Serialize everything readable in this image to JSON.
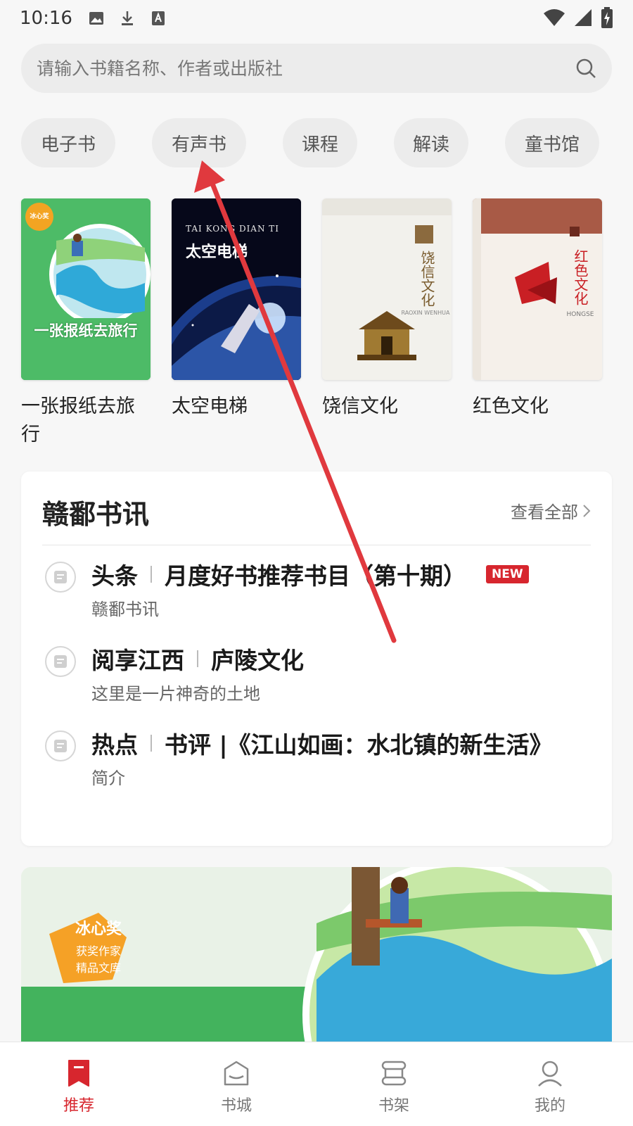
{
  "status_bar": {
    "time": "10:16"
  },
  "search": {
    "placeholder": "请输入书籍名称、作者或出版社"
  },
  "categories": [
    "电子书",
    "有声书",
    "课程",
    "解读",
    "童书馆"
  ],
  "books": [
    {
      "title": "一张报纸去旅行",
      "cover_text": "一张报纸去旅行",
      "cover_badge": "冰心奖"
    },
    {
      "title": "太空电梯",
      "cover_text": "太空电梯",
      "cover_pinyin": "TAI KONG DIAN TI"
    },
    {
      "title": "饶信文化",
      "cover_text": "饶信文化",
      "cover_pinyin": "RAOXIN WENHUA"
    },
    {
      "title": "红色文化",
      "cover_text": "红色文化",
      "cover_pinyin": "HONGSE"
    }
  ],
  "news": {
    "heading": "赣鄱书讯",
    "view_all": "查看全部",
    "items": [
      {
        "tag": "头条",
        "title": "月度好书推荐书目（第十期）",
        "badge": "NEW",
        "sub": "赣鄱书讯"
      },
      {
        "tag": "阅享江西",
        "title": "庐陵文化",
        "sub": "这里是一片神奇的土地"
      },
      {
        "tag": "热点",
        "title": "书评 |《江山如画：水北镇的新生活》",
        "sub": "简介"
      }
    ]
  },
  "banner": {
    "badge_line1": "冰心奖",
    "badge_line2": "获奖作家",
    "badge_line3": "精品文库"
  },
  "bottom_nav": [
    {
      "label": "推荐",
      "icon": "bookmark-icon",
      "active": true
    },
    {
      "label": "书城",
      "icon": "bookstore-icon",
      "active": false
    },
    {
      "label": "书架",
      "icon": "bookshelf-icon",
      "active": false
    },
    {
      "label": "我的",
      "icon": "profile-icon",
      "active": false
    }
  ],
  "colors": {
    "accent": "#d7262e",
    "background": "#f7f7f7",
    "chip": "#ececec"
  }
}
